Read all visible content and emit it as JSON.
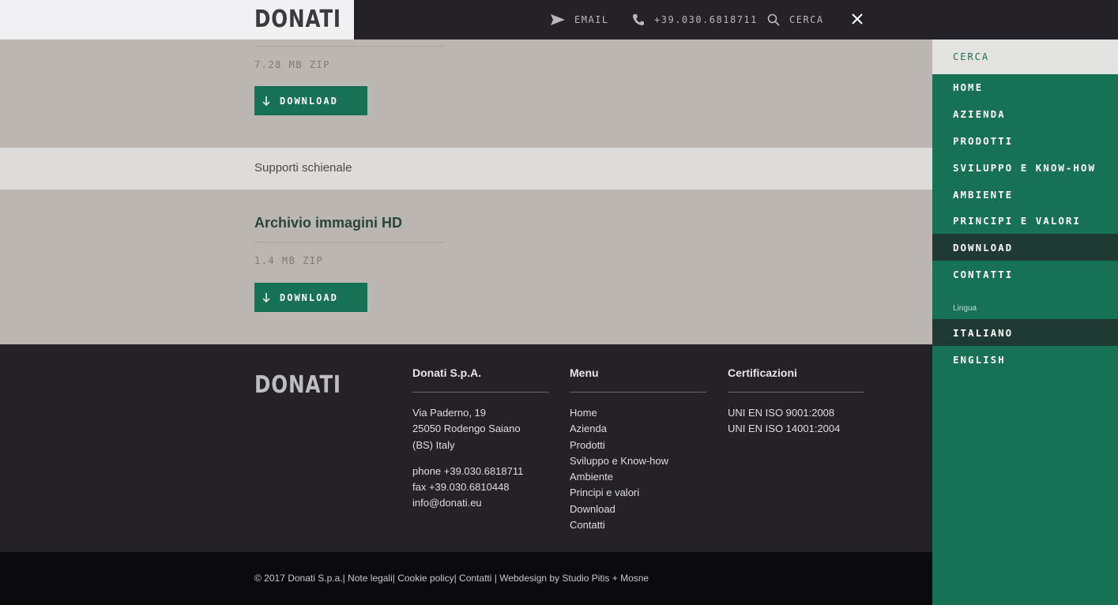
{
  "header": {
    "logo": "DONATI",
    "email_label": "EMAIL",
    "phone_label": "+39.030.6818711",
    "search_label": "CERCA"
  },
  "content": {
    "item1": {
      "meta": "7.28 MB ZIP",
      "download_label": "DOWNLOAD"
    },
    "section_label": "Supporti schienale",
    "item2": {
      "title": "Archivio immagini HD",
      "meta": "1.4 MB ZIP",
      "download_label": "DOWNLOAD"
    }
  },
  "footer": {
    "logo": "DONATI",
    "company": {
      "heading": "Donati S.p.A.",
      "address": [
        "Via Paderno, 19",
        "25050 Rodengo Saiano",
        "(BS) Italy"
      ],
      "contacts": [
        "phone +39.030.6818711",
        "fax +39.030.6810448",
        "info@donati.eu"
      ]
    },
    "menu": {
      "heading": "Menu",
      "items": [
        "Home",
        "Azienda",
        "Prodotti",
        "Sviluppo e Know-how",
        "Ambiente",
        "Principi e valori",
        "Download",
        "Contatti"
      ]
    },
    "certs": {
      "heading": "Certificazioni",
      "items": [
        "UNI EN ISO 9001:2008",
        "UNI EN ISO 14001:2004"
      ]
    }
  },
  "bottom": {
    "copyright": "© 2017 Donati S.p.a.|",
    "links": [
      "Note legali|",
      "Cookie policy|",
      "Contatti",
      "|",
      "Webdesign by Studio Pitis + Mosne"
    ]
  },
  "side_menu": {
    "search_label": "CERCA",
    "items": [
      "HOME",
      "AZIENDA",
      "PRODOTTI",
      "SVILUPPO E KNOW-HOW",
      "AMBIENTE",
      "PRINCIPI E VALORI",
      "DOWNLOAD",
      "CONTATTI"
    ],
    "active_item": "DOWNLOAD",
    "language_heading": "Lingua",
    "languages": [
      "ITALIANO",
      "ENGLISH"
    ],
    "active_language": "ITALIANO"
  },
  "colors": {
    "brand_green": "#167155",
    "active_dark": "#1e3a32",
    "header_dark": "#242226",
    "content_bg": "#bbb6b2"
  }
}
